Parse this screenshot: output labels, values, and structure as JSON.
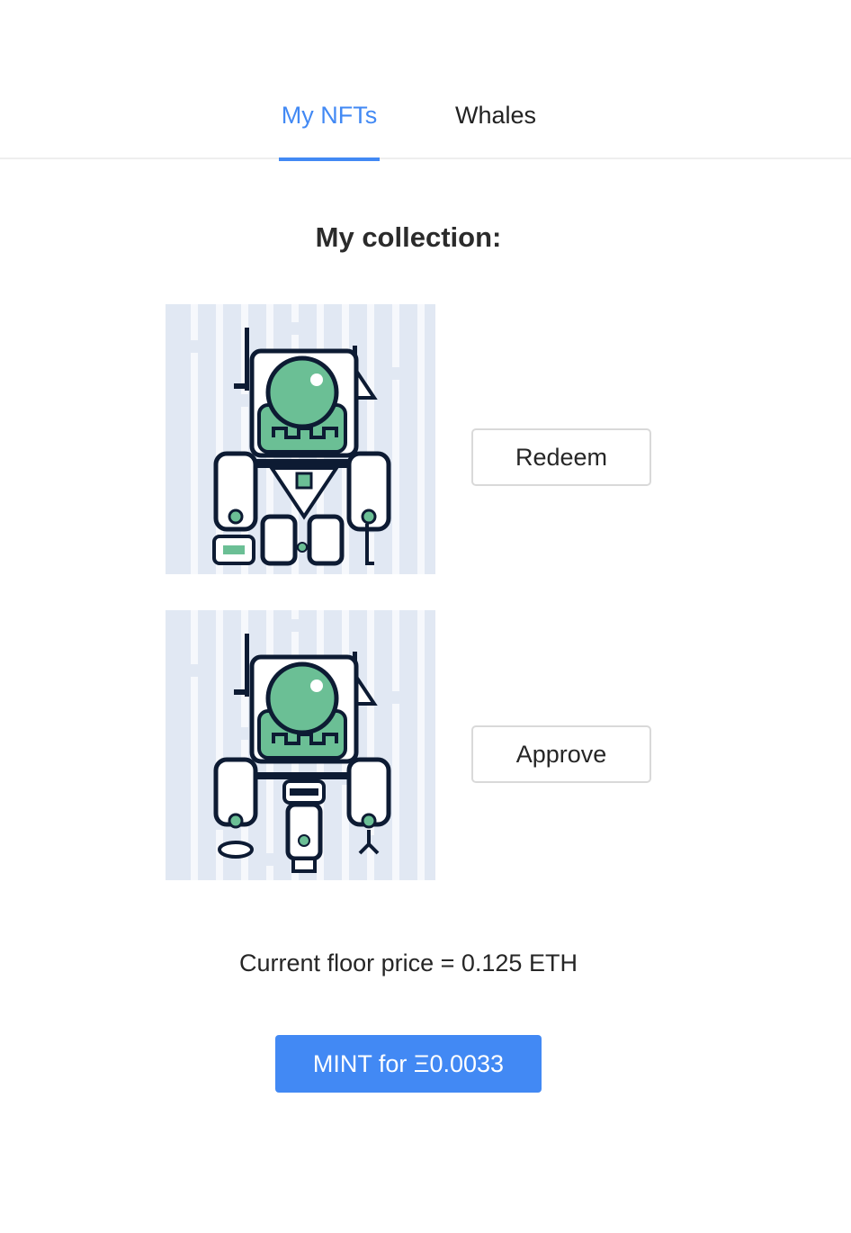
{
  "tabs": [
    {
      "label": "My NFTs",
      "active": true
    },
    {
      "label": "Whales",
      "active": false
    }
  ],
  "collection": {
    "heading": "My collection:",
    "items": [
      {
        "image_icon": "robot-nft-image",
        "action_label": "Redeem"
      },
      {
        "image_icon": "robot-nft-image",
        "action_label": "Approve"
      }
    ]
  },
  "floor_price_text": "Current floor price = 0.125 ETH",
  "mint_button_label": "MINT for Ξ0.0033",
  "colors": {
    "accent": "#4289f4",
    "nft_background": "#e1e8f3",
    "nft_green": "#6bbf95",
    "nft_outline": "#0d1b33"
  }
}
